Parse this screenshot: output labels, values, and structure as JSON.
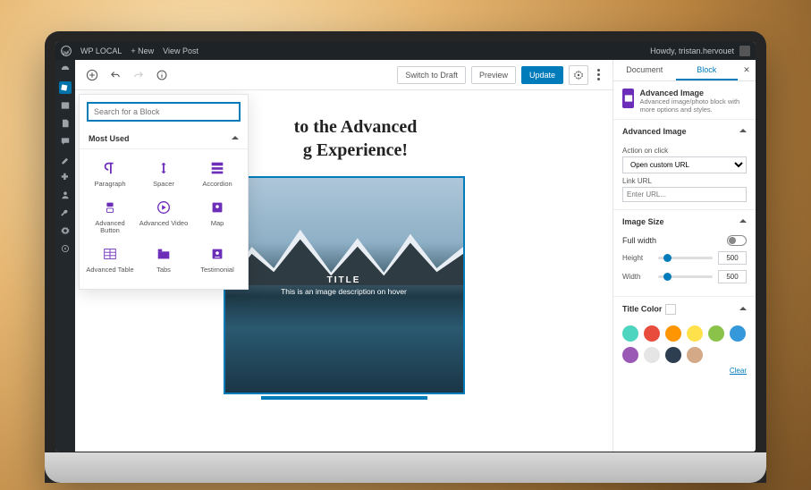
{
  "wpbar": {
    "site": "WP LOCAL",
    "new": "+  New",
    "view": "View Post",
    "howdy": "Howdy, tristan.hervouet"
  },
  "toolbar": {
    "draft": "Switch to Draft",
    "preview": "Preview",
    "update": "Update"
  },
  "inserter": {
    "search_placeholder": "Search for a Block",
    "section": "Most Used",
    "items": [
      "Paragraph",
      "Spacer",
      "Accordion",
      "Advanced Button",
      "Advanced Video",
      "Map",
      "Advanced Table",
      "Tabs",
      "Testimonial"
    ]
  },
  "headline": {
    "line1": "to the Advanced",
    "line2": "g Experience!"
  },
  "image_overlay": {
    "title": "TITLE",
    "sub": "This is an image description on hover"
  },
  "sidebar": {
    "tab_document": "Document",
    "tab_block": "Block",
    "block_title": "Advanced Image",
    "block_desc": "Advanced image/photo block with more options and styles.",
    "panel1": "Advanced Image",
    "action_lbl": "Action on click",
    "action_value": "Open custom URL",
    "link_lbl": "Link URL",
    "link_placeholder": "Enter URL...",
    "panel2": "Image Size",
    "fullwidth": "Full width",
    "height_lbl": "Height",
    "height_val": "500",
    "width_lbl": "Width",
    "width_val": "500",
    "panel3": "Title Color",
    "clear": "Clear",
    "swatches": [
      "#4dd5c0",
      "#e74c3c",
      "#ff9500",
      "#ffe14b",
      "#8bc34a",
      "#3498db",
      "#9b59b6",
      "#e5e5e5",
      "#2c3e50",
      "#d4a988"
    ]
  }
}
